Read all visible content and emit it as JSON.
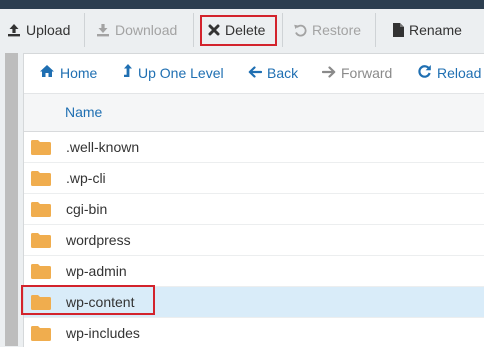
{
  "toolbar": {
    "buttons": [
      {
        "label": "Upload",
        "icon": "upload-icon",
        "enabled": true
      },
      {
        "label": "Download",
        "icon": "download-icon",
        "enabled": false
      },
      {
        "label": "Delete",
        "icon": "close-icon",
        "enabled": true,
        "highlighted": true
      },
      {
        "label": "Restore",
        "icon": "undo-icon",
        "enabled": false
      },
      {
        "label": "Rename",
        "icon": "file-icon",
        "enabled": true
      }
    ]
  },
  "nav": {
    "home": "Home",
    "up_one_level": "Up One Level",
    "back": "Back",
    "forward": "Forward",
    "reload": "Reload"
  },
  "table": {
    "column_name": "Name",
    "rows": [
      {
        "name": ".well-known",
        "icon": "folder-icon"
      },
      {
        "name": ".wp-cli",
        "icon": "folder-icon"
      },
      {
        "name": "cgi-bin",
        "icon": "folder-icon"
      },
      {
        "name": "wordpress",
        "icon": "folder-icon"
      },
      {
        "name": "wp-admin",
        "icon": "folder-icon"
      },
      {
        "name": "wp-content",
        "icon": "folder-icon",
        "selected": true,
        "highlighted": true
      },
      {
        "name": "wp-includes",
        "icon": "folder-icon"
      }
    ]
  },
  "colors": {
    "link": "#1f6fb2",
    "highlight_border": "#d3232c",
    "selected_row": "#d9ecf9",
    "folder": "#f0ad4e",
    "disabled_text": "#a3a3a3"
  }
}
